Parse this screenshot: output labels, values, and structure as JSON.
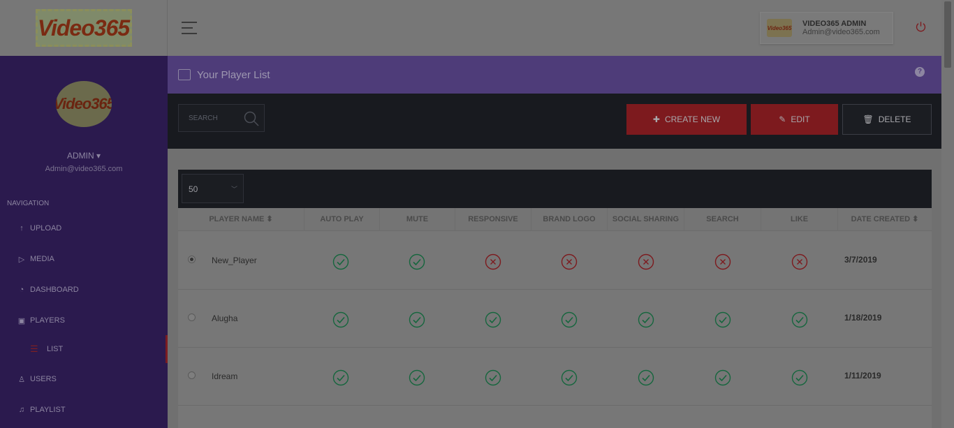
{
  "brand": {
    "logo_text": "Video365"
  },
  "header": {
    "user_name": "VIDEO365 ADMIN",
    "user_email": "Admin@video365.com",
    "mini_logo_text": "Video365"
  },
  "sidebar": {
    "admin_label": "ADMIN ▾",
    "admin_email": "Admin@video365.com",
    "nav_title": "NAVIGATION",
    "items": [
      {
        "label": "UPLOAD",
        "icon": "upload-icon"
      },
      {
        "label": "MEDIA",
        "icon": "play-icon"
      },
      {
        "label": "DASHBOARD",
        "icon": "gauge-icon"
      },
      {
        "label": "PLAYERS",
        "icon": "player-icon"
      },
      {
        "label": "LIST",
        "icon": "list-icon"
      },
      {
        "label": "USERS",
        "icon": "user-icon"
      },
      {
        "label": "PLAYLIST",
        "icon": "playlist-icon"
      }
    ]
  },
  "page": {
    "title": "Your Player List",
    "help": "?",
    "search_placeholder": "SEARCH",
    "create_label": "CREATE NEW",
    "edit_label": "EDIT",
    "delete_label": "DELETE",
    "per_page": "50"
  },
  "table": {
    "columns": [
      "PLAYER NAME ⬍",
      "AUTO PLAY",
      "MUTE",
      "RESPONSIVE",
      "BRAND LOGO",
      "SOCIAL SHARING",
      "SEARCH",
      "LIKE",
      "DATE CREATED ⬍"
    ],
    "rows": [
      {
        "name": "New_Player",
        "selected": true,
        "flags": [
          true,
          true,
          false,
          false,
          false,
          false,
          false
        ],
        "date": "3/7/2019"
      },
      {
        "name": "Alugha",
        "selected": false,
        "flags": [
          true,
          true,
          true,
          true,
          true,
          true,
          true
        ],
        "date": "1/18/2019"
      },
      {
        "name": "Idream",
        "selected": false,
        "flags": [
          true,
          true,
          true,
          true,
          true,
          true,
          true
        ],
        "date": "1/11/2019"
      }
    ]
  },
  "colors": {
    "check": "#15663d",
    "cross": "#7d1a1e",
    "sidebar": "#2b1a4e",
    "header_band": "#4e3c79",
    "toolbar": "#181a1f"
  }
}
